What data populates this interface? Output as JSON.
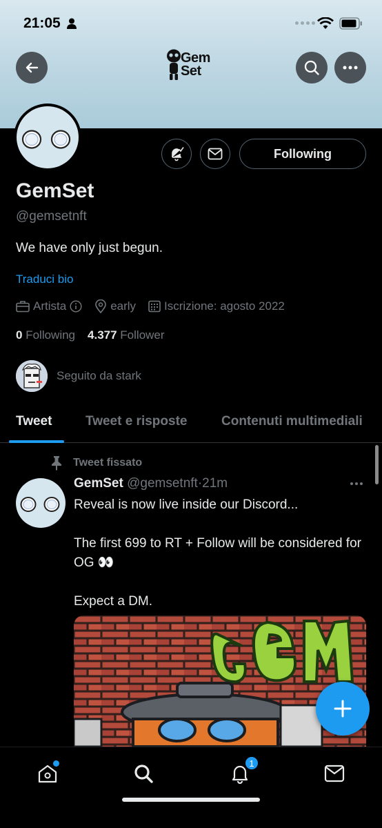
{
  "status_bar": {
    "time": "21:05"
  },
  "header": {
    "logo_line1": "Gem",
    "logo_line2": "Set"
  },
  "profile": {
    "following_button": "Following",
    "display_name": "GemSet",
    "handle": "@gemsetnft",
    "bio": "We have only just begun.",
    "translate_bio": "Traduci bio",
    "category": "Artista",
    "location": "early",
    "joined": "Iscrizione: agosto 2022",
    "following_count": "0",
    "following_label": "Following",
    "followers_count": "4.377",
    "followers_label": "Follower",
    "followed_by": "Seguito da stark"
  },
  "tabs": [
    "Tweet",
    "Tweet e risposte",
    "Contenuti multimediali"
  ],
  "pinned_tweet": {
    "pinned_label": "Tweet fissato",
    "name": "GemSet",
    "handle": "@gemsetnft",
    "separator": "·",
    "time": "21m",
    "line1": "Reveal is now live inside our Discord...",
    "line2": "The first 699 to RT + Follow will be considered for OG 👀",
    "line3": "Expect a DM."
  },
  "bottom_nav": {
    "notification_badge": "1"
  },
  "colors": {
    "accent": "#1d9bf0",
    "background": "#000000",
    "muted": "#71767b"
  },
  "icons": [
    "back-arrow-icon",
    "search-icon",
    "more-icon",
    "bell-icon",
    "mail-icon",
    "briefcase-icon",
    "info-icon",
    "location-pin-icon",
    "calendar-icon",
    "pin-icon",
    "plus-icon",
    "home-icon"
  ]
}
